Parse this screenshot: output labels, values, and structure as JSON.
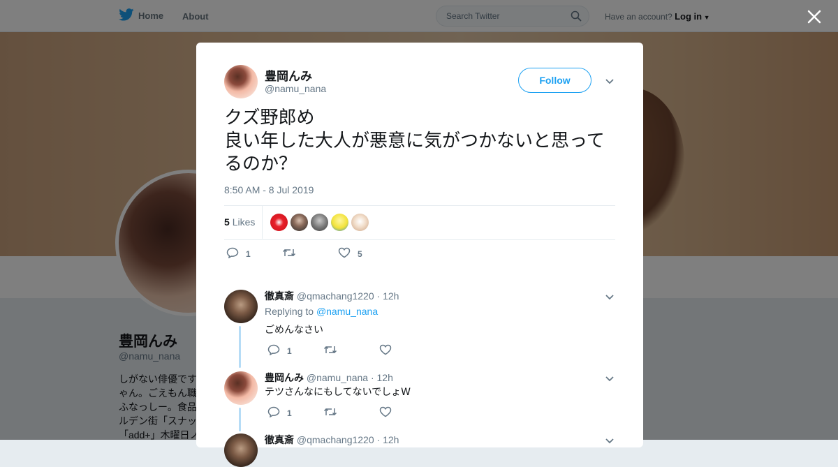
{
  "nav": {
    "home_label": "Home",
    "about_label": "About",
    "search_placeholder": "Search Twitter",
    "account_prompt": "Have an account?",
    "login_label": "Log in"
  },
  "profile_bg": {
    "name": "豊岡んみ",
    "handle": "@namu_nana",
    "bio_lines": [
      "しがない俳優です",
      "ゃん。ごえもん職",
      "ふなっしー。食品",
      "ルデン街「スナッ",
      "「add+」木曜日ノ"
    ]
  },
  "tweet": {
    "author_name": "豊岡んみ",
    "author_handle": "@namu_nana",
    "follow_label": "Follow",
    "text": "クズ野郎め\n良い年した大人が悪意に気がつかないと思ってるのか？",
    "timestamp": "8:50 AM - 8 Jul 2019",
    "likes_count": "5",
    "likes_label": "Likes",
    "reply_count": "1",
    "retweet_count": "",
    "like_count": "5"
  },
  "replies": [
    {
      "name": "徹真斎",
      "handle": "@qmachang1220",
      "time": "· 12h",
      "replying_prefix": "Replying to",
      "replying_to": "@namu_nana",
      "text": "ごめんなさい",
      "reply_count": "1",
      "retweet_count": "",
      "like_count": ""
    },
    {
      "name": "豊岡んみ",
      "handle": "@namu_nana",
      "time": "· 12h",
      "text": "テツさんなにもしてないでしょW",
      "reply_count": "1",
      "retweet_count": "",
      "like_count": ""
    },
    {
      "name": "徹真斎",
      "handle": "@qmachang1220",
      "time": "· 12h"
    }
  ],
  "colors": {
    "brand": "#1da1f2",
    "thread_line": "#b6dcf6",
    "secondary_text": "#657786"
  }
}
